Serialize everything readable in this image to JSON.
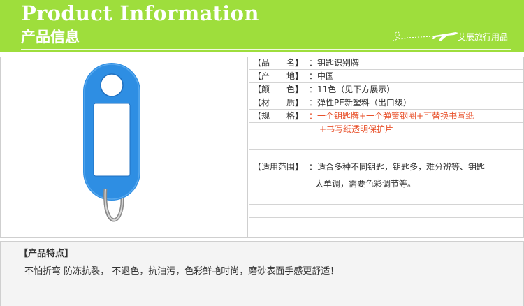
{
  "header": {
    "title_en": "Product Information",
    "title_cn": "产品信息",
    "brand": "艾辰旅行用品"
  },
  "product": {
    "image_icon": "blue-key-tag-with-split-ring",
    "tag_color": "#2e8ee3"
  },
  "specs": [
    {
      "label": "【品　　名】",
      "value": "：钥匙识别牌"
    },
    {
      "label": "【产　　地】",
      "value": "：中国"
    },
    {
      "label": "【颜　　色】",
      "value": "：11色（见下方展示）"
    },
    {
      "label": "【材　　质】",
      "value": "：弹性PE新塑料（出口级）"
    },
    {
      "label": "【规　　格】",
      "value": "：一个钥匙牌+一个弹簧钢圈+可替换书写纸",
      "value_line2": "+书写纸透明保护片"
    },
    {
      "label": "【适用范围】",
      "value": "：适合多种不同钥匙，钥匙多，难分辨等、钥匙",
      "value_line2": "太单调，需要色彩调节等。"
    }
  ],
  "features": {
    "title": "【产品特点】",
    "text": "不怕折弯 防冻抗裂， 不退色，抗油污，色彩鲜艳时尚，磨砂表面手感更舒适！"
  },
  "colors": {
    "header_bg": "#9ede3c",
    "accent_red": "#e8502a",
    "features_bg": "#f4f4f4"
  }
}
